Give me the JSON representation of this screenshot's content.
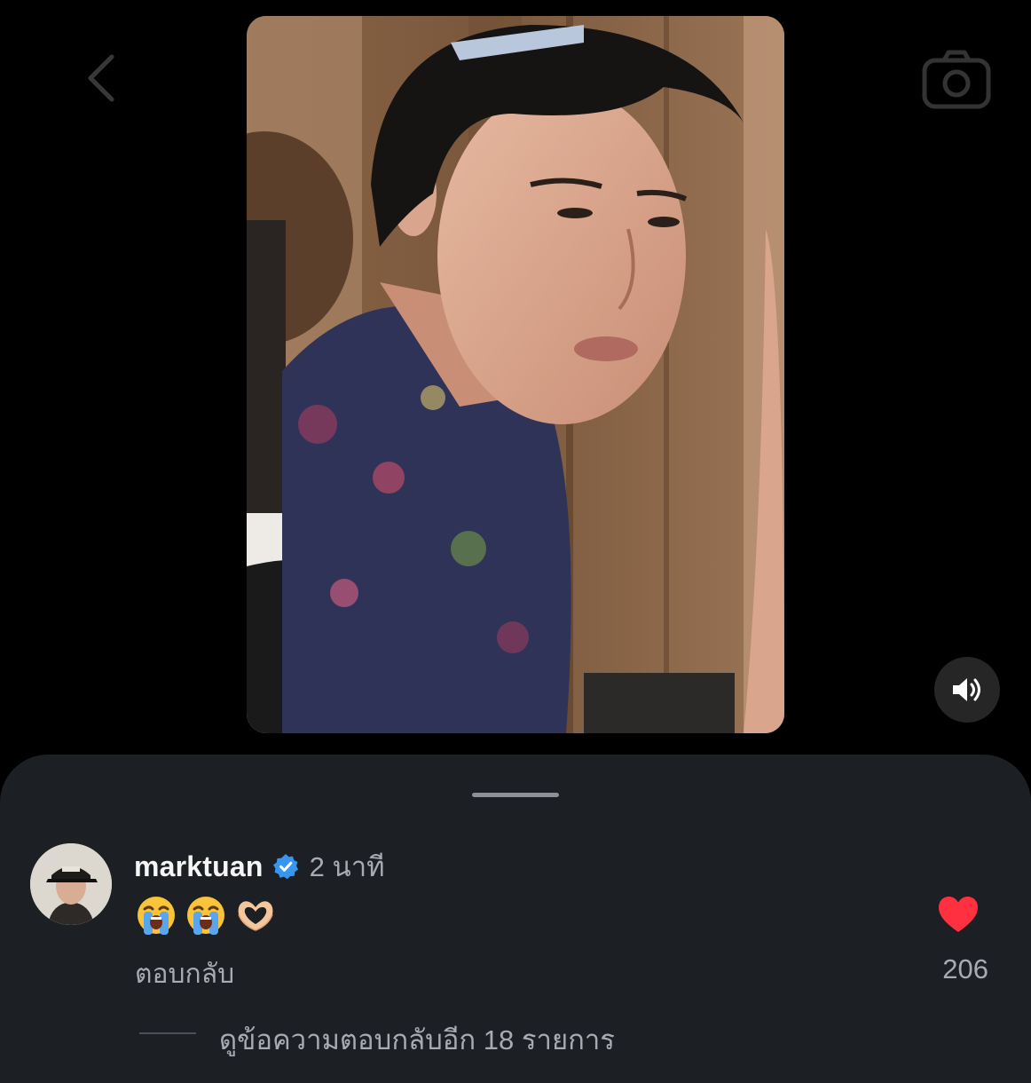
{
  "viewer": {
    "back_icon": "chevron-left-icon",
    "camera_icon": "camera-icon",
    "sound_icon": "speaker-on-icon"
  },
  "comment": {
    "username": "marktuan",
    "verified": true,
    "time": "2 นาที",
    "emojis": [
      "loudly-crying-face",
      "loudly-crying-face",
      "heart-hands"
    ],
    "reply_label": "ตอบกลับ",
    "like_count": "206",
    "view_replies_label": "ดูข้อความตอบกลับอีก 18 รายการ"
  },
  "colors": {
    "sheet_bg": "#1c1f24",
    "verified_blue": "#3797f0",
    "like_red": "#ff3040",
    "secondary_text": "#a8abb1"
  }
}
